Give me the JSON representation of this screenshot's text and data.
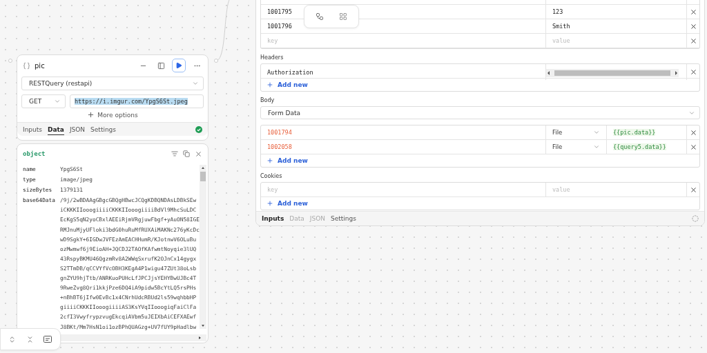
{
  "query_node": {
    "title": "pic",
    "source": "RESTQuery (restapi)",
    "method": "GET",
    "url": {
      "value": "https://i.imgur.com/YpgS6St.jpeg",
      "selected": true
    },
    "more_options": "More options",
    "succeeded": true,
    "tabs": [
      {
        "label": "Inputs",
        "selected": false
      },
      {
        "label": "Data",
        "selected": true
      },
      {
        "label": "JSON",
        "selected": false
      },
      {
        "label": "Settings",
        "selected": false
      }
    ]
  },
  "data_panel": {
    "title": "object",
    "fields": [
      {
        "key": "name",
        "lines": [
          "YpgS6St"
        ]
      },
      {
        "key": "type",
        "lines": [
          "image/jpeg"
        ]
      },
      {
        "key": "sizeBytes",
        "lines": [
          "1379131"
        ]
      },
      {
        "key": "base64Data",
        "lines": [
          "/9j/2wBDAAgGBgcGBQgHBwcJCQgKDBQNDAsLDBkSEw",
          "iCKKKIIooogiiiiCKKKIIooogiiiiBdVl9MhcSuLDC",
          "EcKgS5qN2yoCBxlAEEiRjmVRgjuwFbgf+yAuON58IGE",
          "RMJnuMjyUFloki3bdG0huRuMfRUXAiMAKNc276yKcDc",
          "wD9SgkY+6IGDwJVFEzAmEACHHumR/KJotnwV6OLuBu",
          "ozMwmwf6j9EioAH+JQCDJ2TAOfKAfwmtNoyqie3lUQ",
          "43RspyBKMU46QgzmRv8A2WWqSxrufK2OJnCx14gygx",
          "S2TTmDB/qCCVYfVcOBH3KEgA4P1wigu47ZUt38oLsb",
          "gnZYU9hjTtb/ANRKuoPUHcLfJPCJjsYEHYBwUJBc4T",
          "9RweZvg8Qri1kkjPze6DQ4iA9pidw5BcYtLQ5rsPHs",
          "+nBhBT6jIfw0EvBc1x4CNrhUdcRBUd2ls59wqhbbHP",
          "giiiiCKKKIIooogiiiiAS3KsYVqIIooogiqFaiClFa",
          "2cfI3VwyfrypzvugEkcqiAVbm5uJEIXbAiCEFXAEwf",
          "J8BKt/Mm7HsN1oi1ozBPhQUAGzg+UV7fUY9pHadlbw"
        ]
      }
    ]
  },
  "request_panel": {
    "params": [
      {
        "key": {
          "value": "1001795"
        },
        "value": {
          "value": "123"
        }
      },
      {
        "key": {
          "value": "1001796"
        },
        "value": {
          "value": "Smith"
        }
      },
      {
        "key": {
          "placeholder": "key"
        },
        "value": {
          "placeholder": "value"
        }
      }
    ],
    "headers": {
      "label": "Headers",
      "rows": [
        {
          "key": {
            "value": "Authorization"
          },
          "value_covered": true
        }
      ],
      "add_new": "Add new"
    },
    "body": {
      "label": "Body",
      "encoding": "Form Data",
      "rows": [
        {
          "key": "1001794",
          "type": "File",
          "value": "{{pic.data}}"
        },
        {
          "key": "1002058",
          "type": "File",
          "value": "{{query5.data}}"
        }
      ],
      "add_new": "Add new"
    },
    "cookies": {
      "label": "Cookies",
      "rows": [
        {
          "key": {
            "placeholder": "key"
          },
          "value": {
            "placeholder": "value"
          }
        }
      ],
      "add_new": "Add new"
    },
    "tabs": [
      {
        "label": "Inputs",
        "selected": true,
        "disabled": false
      },
      {
        "label": "Data",
        "selected": false,
        "disabled": true
      },
      {
        "label": "JSON",
        "selected": false,
        "disabled": true
      },
      {
        "label": "Settings",
        "selected": false,
        "disabled": false
      }
    ]
  }
}
